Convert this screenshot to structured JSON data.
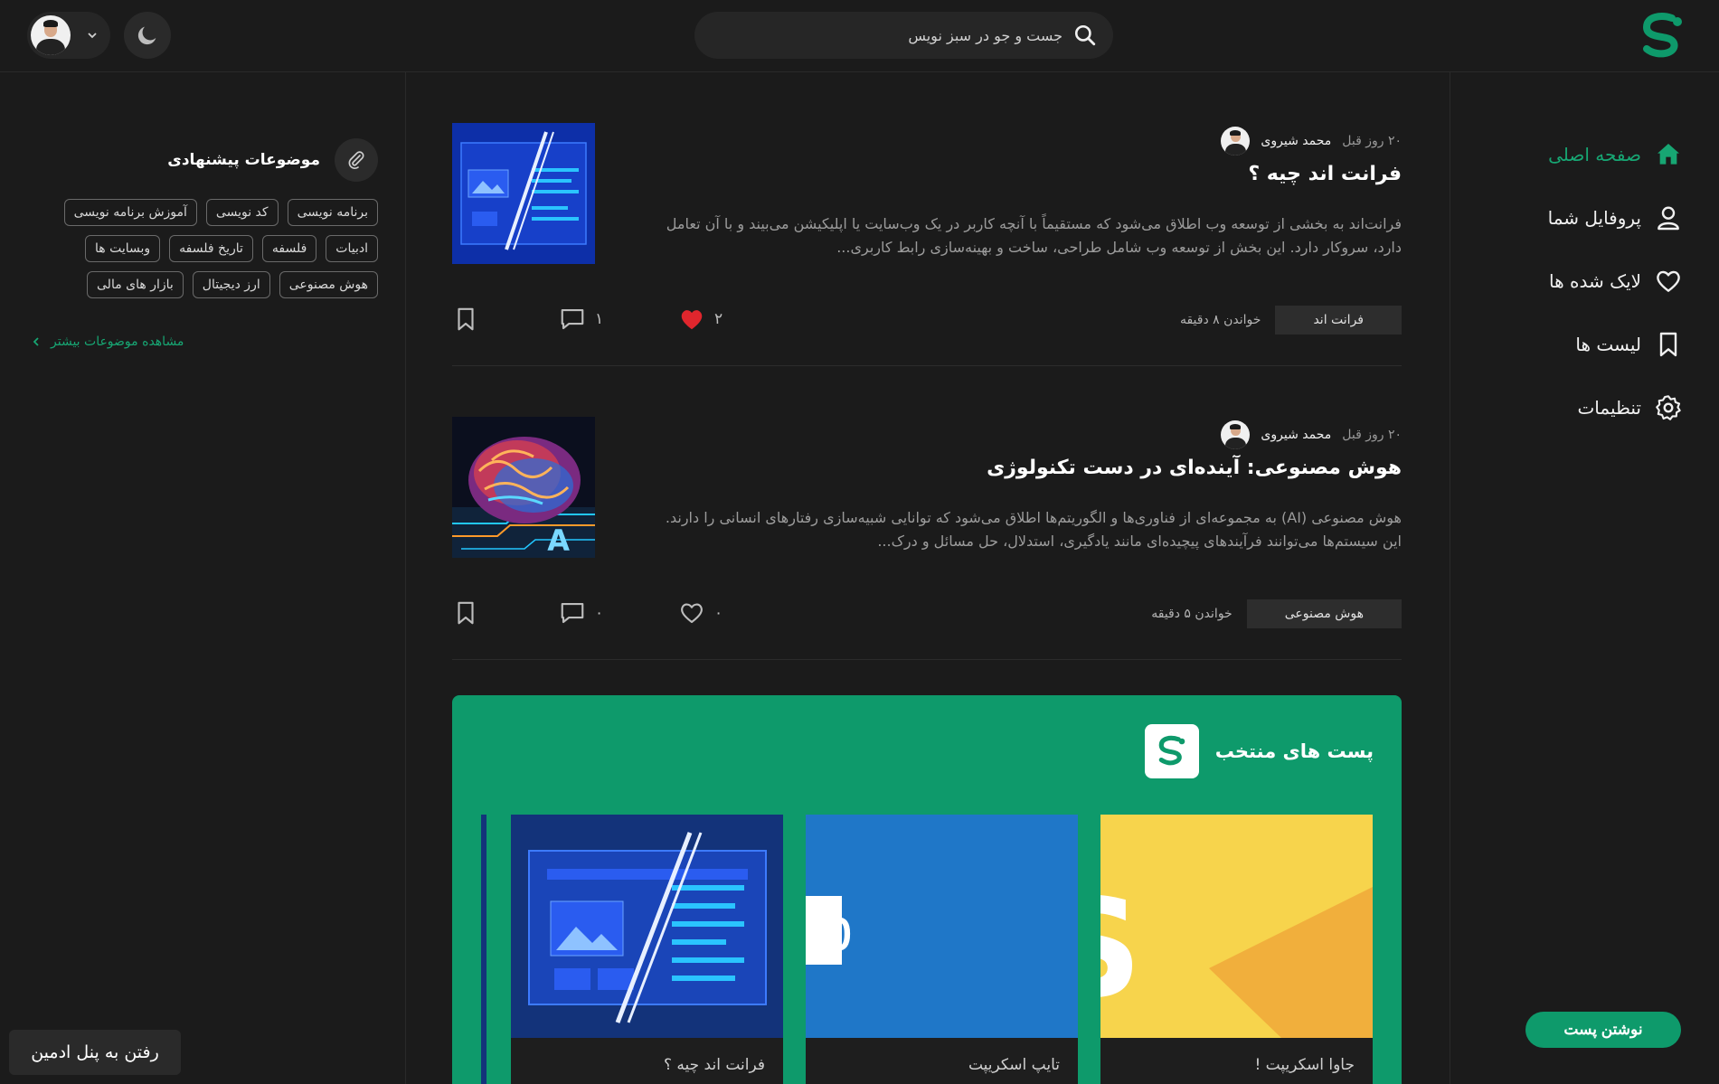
{
  "header": {
    "search_placeholder": "جست و جو در سبز نویس"
  },
  "nav": {
    "items": [
      {
        "label": "صفحه اصلی",
        "active": true,
        "icon": "home-icon"
      },
      {
        "label": "پروفایل شما",
        "active": false,
        "icon": "user-icon"
      },
      {
        "label": "لایک شده ها",
        "active": false,
        "icon": "heart-icon"
      },
      {
        "label": "لیست ها",
        "active": false,
        "icon": "bookmark-icon"
      },
      {
        "label": "تنظیمات",
        "active": false,
        "icon": "gear-icon"
      }
    ],
    "write_post_label": "نوشتن پست"
  },
  "sidebar": {
    "topics_title": "موضوعات پیشنهادی",
    "tags": [
      "برنامه نویسی",
      "کد نویسی",
      "آموزش برنامه نویسی",
      "ادبیات",
      "فلسفه",
      "تاریخ فلسفه",
      "وبسایت ها",
      "هوش مصنوعی",
      "ارز دیجیتال",
      "بازار های مالی"
    ],
    "more_topics_label": "مشاهده موضوعات بیشتر",
    "admin_button_label": "رفتن به پنل ادمین"
  },
  "posts": [
    {
      "author": "محمد شیروی",
      "time": "۲۰ روز قبل",
      "title": "فرانت اند چیه ؟",
      "excerpt": "فرانت‌اند به بخشی از توسعه وب اطلاق می‌شود که مستقیماً با آنچه کاربر در یک وب‌سایت یا اپلیکیشن می‌بیند و با آن تعامل دارد، سروکار دارد. این بخش از توسعه وب شامل طراحی، ساخت و بهینه‌سازی رابط کاربری...",
      "category": "فرانت اند",
      "read_time": "خواندن ۸ دقیقه",
      "likes": "۲",
      "liked": true,
      "comments": "۱"
    },
    {
      "author": "محمد شیروی",
      "time": "۲۰ روز قبل",
      "title": "هوش مصنوعی: آینده‌ای در دست تکنولوژی",
      "excerpt": "هوش مصنوعی (AI) به مجموعه‌ای از فناوری‌ها و الگوریتم‌ها اطلاق می‌شود که توانایی شبیه‌سازی رفتارهای انسانی را دارند. این سیستم‌ها می‌توانند فرآیندهای پیچیده‌ای مانند یادگیری، استدلال، حل مسائل و درک...",
      "category": "هوش مصنوعی",
      "read_time": "خواندن ۵ دقیقه",
      "likes": "۰",
      "liked": false,
      "comments": "۰"
    }
  ],
  "featured": {
    "title": "پست های منتخب",
    "cards": [
      {
        "caption": "جاوا اسکریپت !",
        "image_text": "JS",
        "accent": "#f7d44c"
      },
      {
        "caption": "تایپ اسکریپت",
        "image_text": "TypeScrip",
        "image_badge": "TS",
        "accent": "#1f77c8"
      },
      {
        "caption": "فرانت اند چیه ؟",
        "accent": "#13337a"
      }
    ]
  },
  "colors": {
    "brand_green": "#0e9a6b",
    "active_green": "#17a673",
    "like_red": "#e0262d",
    "background": "#1b1b1b"
  }
}
